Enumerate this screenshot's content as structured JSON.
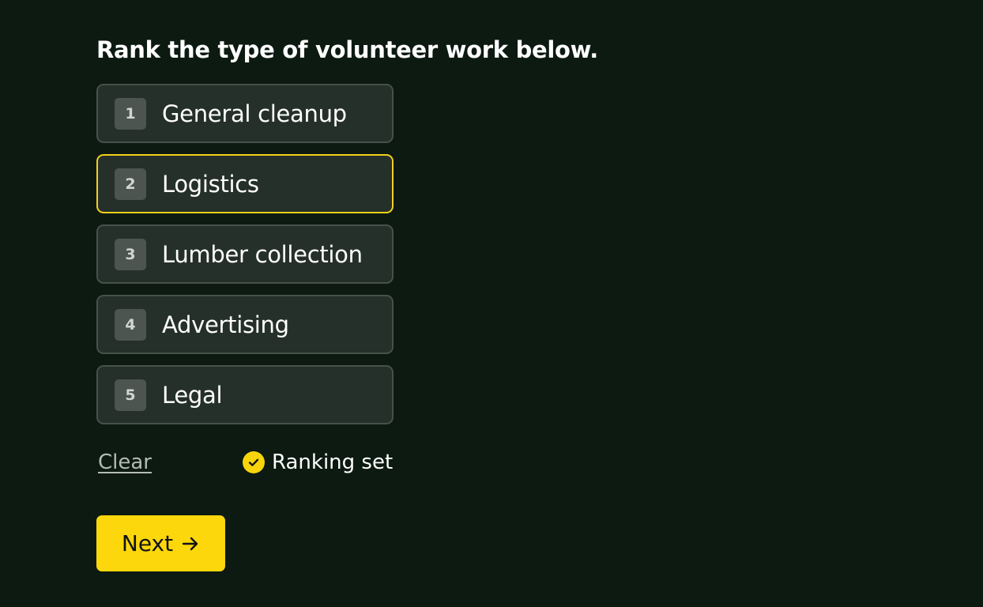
{
  "question": {
    "text": "Rank the type of volunteer work below."
  },
  "ranking": {
    "items": [
      {
        "rank": "1",
        "label": "General cleanup"
      },
      {
        "rank": "2",
        "label": "Logistics",
        "focused": true
      },
      {
        "rank": "3",
        "label": "Lumber collection"
      },
      {
        "rank": "4",
        "label": "Advertising"
      },
      {
        "rank": "5",
        "label": "Legal"
      }
    ]
  },
  "actions": {
    "clear_label": "Clear",
    "status_text": "Ranking set",
    "status_icon": "check-circle-icon",
    "next_label": "Next",
    "next_icon": "arrow-right-icon"
  },
  "colors": {
    "background": "#0c1a12",
    "item_background": "#25302a",
    "item_border": "#47514c",
    "focus_border": "#f4cf1c",
    "accent": "#fcd70c"
  }
}
